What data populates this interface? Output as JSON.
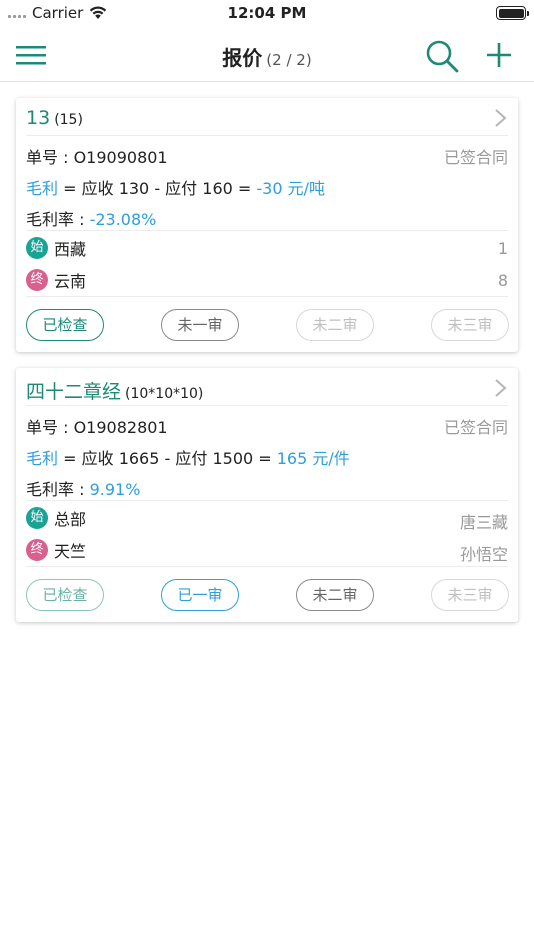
{
  "status_bar": {
    "carrier": "Carrier",
    "time": "12:04 PM"
  },
  "nav": {
    "title": "报价",
    "count": "(2 / 2)"
  },
  "labels": {
    "order_no_prefix": "单号 : ",
    "gross_profit": "毛利",
    "eq_receivable": " = 应收 ",
    "minus_payable": " - 应付 ",
    "equals": " = ",
    "margin_rate": "毛利率 : ",
    "start_badge": "始",
    "end_badge": "终"
  },
  "cards": [
    {
      "title": "13",
      "subtitle": "(15)",
      "order_no": "O19090801",
      "status": "已签合同",
      "receivable": "130",
      "payable": "160",
      "profit": "-30 元/吨",
      "margin_rate": "-23.08%",
      "origin": "西藏",
      "origin_right": "1",
      "destination": "云南",
      "destination_right": "8",
      "buttons": [
        "已检查",
        "未一审",
        "未二审",
        "未三审"
      ]
    },
    {
      "title": "四十二章经",
      "subtitle": "(10*10*10)",
      "order_no": "O19082801",
      "status": "已签合同",
      "receivable": "1665",
      "payable": "1500",
      "profit": "165 元/件",
      "margin_rate": "9.91%",
      "origin": "总部",
      "origin_right": "唐三藏",
      "destination": "天竺",
      "destination_right": "孙悟空",
      "buttons": [
        "已检查",
        "已一审",
        "未二审",
        "未三审"
      ]
    }
  ],
  "colors": {
    "brand_green": "#1e8a76",
    "link_blue": "#2f9fd8",
    "start_badge": "#1aa395",
    "end_badge": "#d9608e"
  }
}
